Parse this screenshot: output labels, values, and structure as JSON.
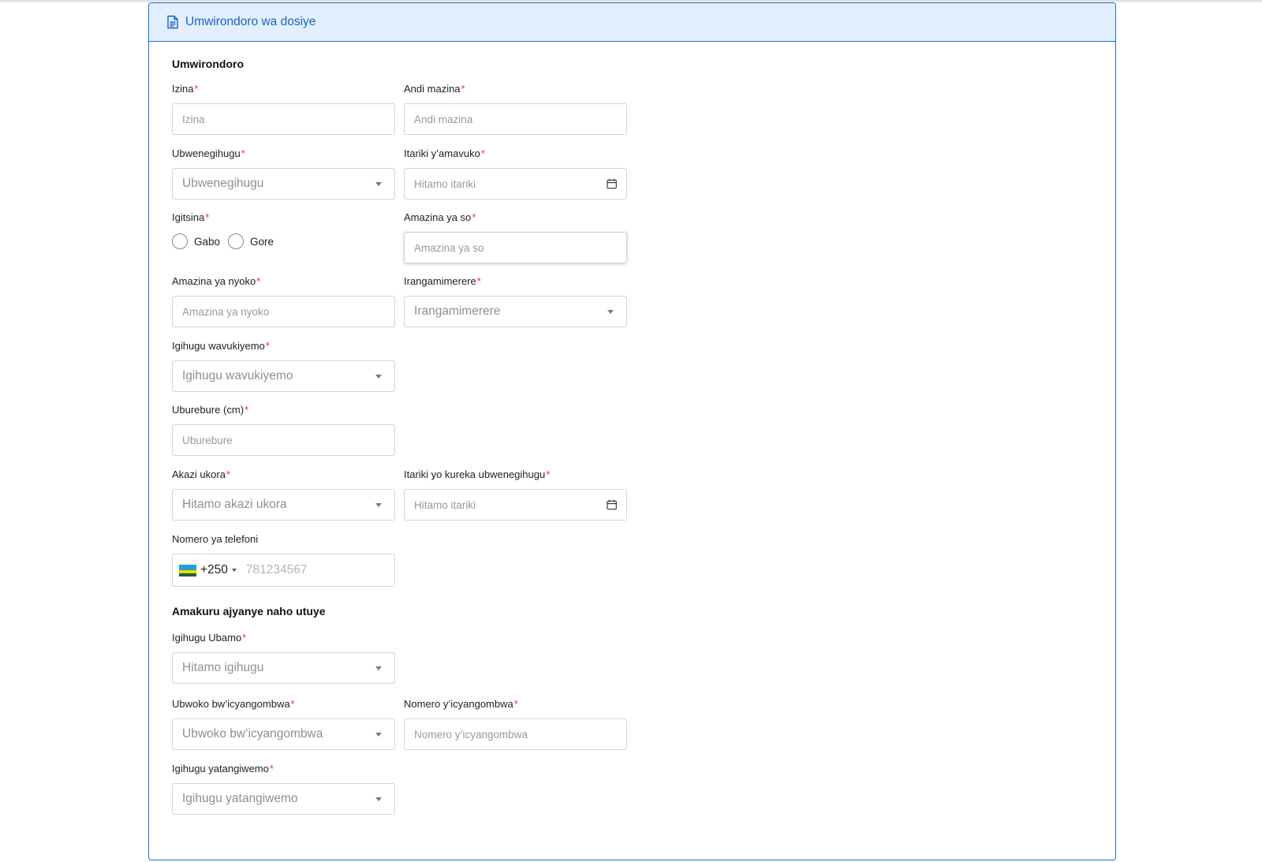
{
  "panel": {
    "title": "Umwirondoro wa dosiye",
    "icon": "document-icon",
    "accent_color": "#1f6fd1",
    "header_bg": "#e3efff"
  },
  "sections": {
    "profile": "Umwirondoro",
    "residence": "Amakuru ajyanye naho utuye"
  },
  "required_marker": "*",
  "fields": {
    "first_name": {
      "label": "Izina",
      "placeholder": "Izina"
    },
    "other_names": {
      "label": "Andi mazina",
      "placeholder": "Andi mazina"
    },
    "nationality": {
      "label": "Ubwenegihugu",
      "value": "Ubwenegihugu"
    },
    "birth_date": {
      "label": "Itariki y’amavuko",
      "placeholder": "Hitamo itariki"
    },
    "gender": {
      "label": "Igitsina",
      "options": [
        "Gabo",
        "Gore"
      ]
    },
    "father_name": {
      "label": "Amazina ya so",
      "placeholder": "Amazina ya so"
    },
    "mother_name": {
      "label": "Amazina ya nyoko",
      "placeholder": "Amazina ya nyoko"
    },
    "marital_status": {
      "label": "Irangamimerere",
      "value": "Irangamimerere"
    },
    "birth_country": {
      "label": "Igihugu wavukiyemo",
      "value": "Igihugu wavukiyemo"
    },
    "height": {
      "label": "Uburebure (cm)",
      "placeholder": "Uburebure"
    },
    "occupation": {
      "label": "Akazi ukora",
      "value": "Hitamo akazi ukora"
    },
    "citizenship_end_date": {
      "label": "Itariki yo kureka ubwenegihugu",
      "placeholder": "Hitamo itariki"
    },
    "phone": {
      "label": "Nomero ya telefoni",
      "dial_code": "+250",
      "placeholder": "781234567",
      "flag": "rwanda-flag-icon"
    },
    "residence_country": {
      "label": "Igihugu Ubamo",
      "value": "Hitamo igihugu"
    },
    "id_type": {
      "label": "Ubwoko bw’icyangombwa",
      "value": "Ubwoko bw’icyangombwa"
    },
    "id_number": {
      "label": "Nomero y’icyangombwa",
      "placeholder": "Nomero y’icyangombwa"
    },
    "issuing_country": {
      "label": "Igihugu yatangiwemo",
      "value": "Igihugu yatangiwemo"
    }
  }
}
